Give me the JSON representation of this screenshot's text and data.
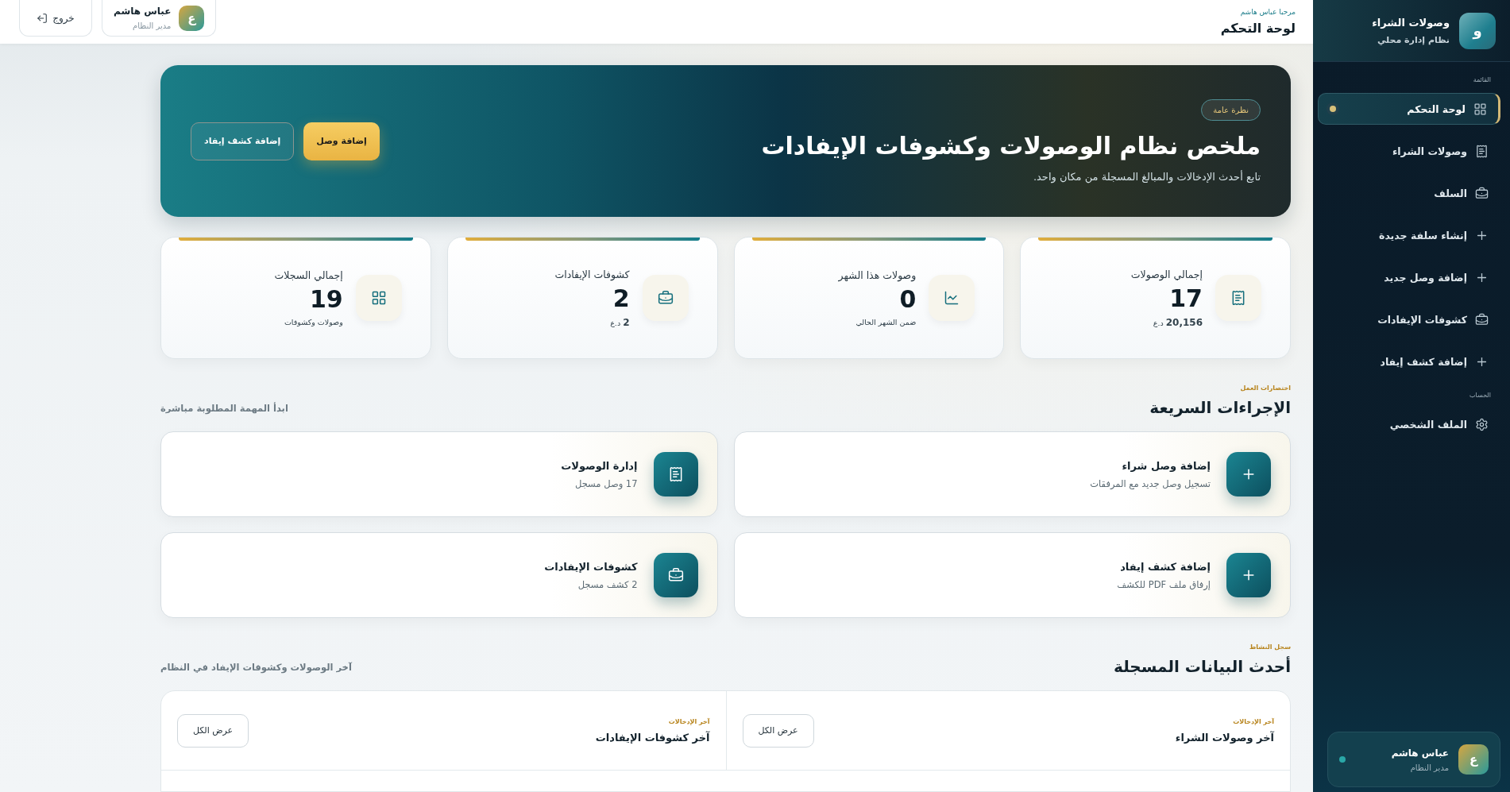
{
  "sidebar": {
    "logo_letter": "و",
    "title": "وصولات الشراء",
    "subtitle": "نظام إدارة محلي",
    "sections": [
      {
        "label": "القائمة",
        "items": [
          {
            "label": "لوحة التحكم",
            "kind": "grid",
            "selected": true
          },
          {
            "label": "وصولات الشراء",
            "kind": "receipt",
            "selected": false
          },
          {
            "label": "السلف",
            "kind": "briefcase",
            "selected": false
          },
          {
            "label": "إنشاء سلفة جديدة",
            "kind": "plus",
            "selected": false
          },
          {
            "label": "إضافة وصل جديد",
            "kind": "plus",
            "selected": false
          },
          {
            "label": "كشوفات الإيفادات",
            "kind": "briefcase",
            "selected": false
          },
          {
            "label": "إضافة كشف إيفاد",
            "kind": "plus",
            "selected": false
          }
        ]
      },
      {
        "label": "الحساب",
        "items": [
          {
            "label": "الملف الشخصي",
            "kind": "settings",
            "selected": false
          }
        ]
      }
    ],
    "user": {
      "avatar": "ع",
      "name": "عباس هاشم",
      "role": "مدير النظام"
    }
  },
  "topbar": {
    "greeting": "مرحبا عباس هاشم",
    "title": "لوحة التحكم",
    "user": {
      "avatar": "ع",
      "name": "عباس هاشم",
      "role": "مدير النظام"
    },
    "logout": "خروج"
  },
  "hero": {
    "badge": "نظرة عامة",
    "title": "ملخص نظام الوصولات وكشوفات الإيفادات",
    "subtitle": "تابع أحدث الإدخالات والمبالغ المسجلة من مكان واحد.",
    "buttons": [
      {
        "label": "إضافة وصل",
        "kind": "primary"
      },
      {
        "label": "إضافة كشف إيفاد",
        "kind": "outline"
      }
    ]
  },
  "stats": [
    {
      "label": "إجمالي الوصولات",
      "value": "17",
      "sub": "**20,156** د.ع",
      "kind": "receipt"
    },
    {
      "label": "وصولات هذا الشهر",
      "value": "0",
      "sub": "ضمن الشهر الحالي",
      "kind": "chart"
    },
    {
      "label": "كشوفات الإيفادات",
      "value": "2",
      "sub": "**2** د.ع",
      "kind": "briefcase"
    },
    {
      "label": "إجمالي السجلات",
      "value": "19",
      "sub": "وصولات وكشوفات",
      "kind": "grid"
    }
  ],
  "quick": {
    "kicker": "اختصارات العمل",
    "title": "الإجراءات السريعة",
    "hint": "ابدأ المهمة المطلوبة مباشرة",
    "actions": [
      {
        "title": "إضافة وصل شراء",
        "sub": "تسجيل وصل جديد مع المرفقات",
        "kind": "plus"
      },
      {
        "title": "إدارة الوصولات",
        "sub": "17 وصل مسجل",
        "kind": "receipt"
      },
      {
        "title": "إضافة كشف إيفاد",
        "sub": "إرفاق ملف PDF للكشف",
        "kind": "plus"
      },
      {
        "title": "كشوفات الإيفادات",
        "sub": "2 كشف مسجل",
        "kind": "briefcase"
      }
    ]
  },
  "recent": {
    "kicker": "سجل النشاط",
    "title": "أحدث البيانات المسجلة",
    "hint": "آخر الوصولات وكشوفات الإيفاد في النظام",
    "panels": [
      {
        "kicker": "آخر الإدخالات",
        "title": "آخر وصولات الشراء",
        "button": "عرض الكل"
      },
      {
        "kicker": "آخر الإدخالات",
        "title": "آخر كشوفات الإيفادات",
        "button": "عرض الكل"
      }
    ]
  }
}
